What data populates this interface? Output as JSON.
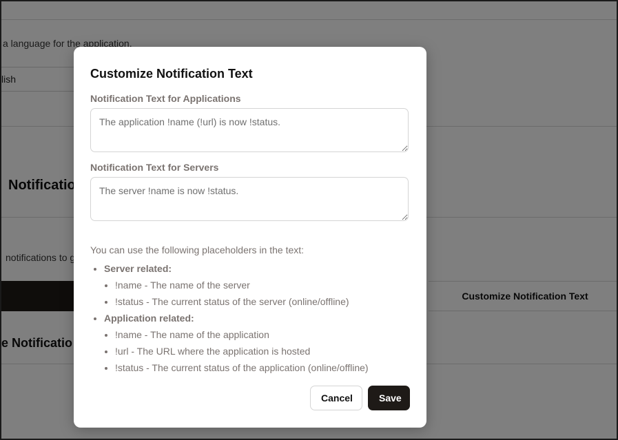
{
  "background": {
    "language_help": "a language for the application.",
    "language_value": "lish",
    "notifications_heading": "Notificatio",
    "notifications_help": "notifications to g",
    "customize_link": "Customize Notification Text",
    "manage_heading": "e Notificatio"
  },
  "modal": {
    "title": "Customize Notification Text",
    "app_label": "Notification Text for Applications",
    "app_value": "The application !name (!url) is now !status.",
    "server_label": "Notification Text for Servers",
    "server_value": "The server !name is now !status.",
    "help_text": "You can use the following placeholders in the text:",
    "groups": [
      {
        "title": "Server related:",
        "items": [
          "!name - The name of the server",
          "!status - The current status of the server (online/offline)"
        ]
      },
      {
        "title": "Application related:",
        "items": [
          "!name - The name of the application",
          "!url - The URL where the application is hosted",
          "!status - The current status of the application (online/offline)"
        ]
      }
    ],
    "cancel_label": "Cancel",
    "save_label": "Save"
  },
  "colors": {
    "primary_button": "#1e1a17",
    "label_gray": "#7a7370",
    "overlay": "rgba(0,0,0,0.5)"
  }
}
